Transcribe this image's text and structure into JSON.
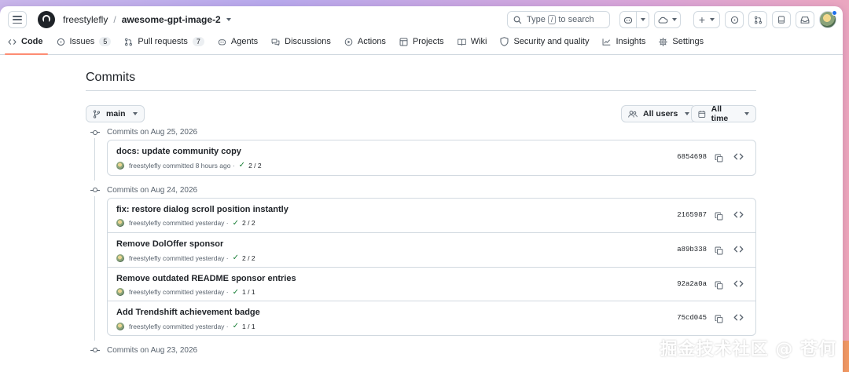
{
  "header": {
    "owner": "freestylefly",
    "separator": "/",
    "repo": "awesome-gpt-image-2",
    "search_prefix": "Type",
    "search_key": "/",
    "search_suffix": "to search"
  },
  "tabs": [
    {
      "label": "Code",
      "icon": "code-icon",
      "active": true
    },
    {
      "label": "Issues",
      "icon": "issue-icon",
      "count": "5"
    },
    {
      "label": "Pull requests",
      "icon": "pull-request-icon",
      "count": "7"
    },
    {
      "label": "Agents",
      "icon": "agents-icon"
    },
    {
      "label": "Discussions",
      "icon": "discussion-icon"
    },
    {
      "label": "Actions",
      "icon": "play-icon"
    },
    {
      "label": "Projects",
      "icon": "table-icon"
    },
    {
      "label": "Wiki",
      "icon": "book-icon"
    },
    {
      "label": "Security and quality",
      "icon": "shield-icon"
    },
    {
      "label": "Insights",
      "icon": "graph-icon"
    },
    {
      "label": "Settings",
      "icon": "gear-icon"
    }
  ],
  "page": {
    "title": "Commits",
    "branch": "main",
    "users_filter": "All users",
    "time_filter": "All time"
  },
  "groups": [
    {
      "heading": "Commits on Aug 25, 2026",
      "commits": [
        {
          "message": "docs: update community copy",
          "author": "freestylefly",
          "when": "committed 8 hours ago",
          "checks": "2 / 2",
          "sha": "6854698"
        }
      ]
    },
    {
      "heading": "Commits on Aug 24, 2026",
      "commits": [
        {
          "message": "fix: restore dialog scroll position instantly",
          "author": "freestylefly",
          "when": "committed yesterday",
          "checks": "2 / 2",
          "sha": "2165987"
        },
        {
          "message": "Remove DolOffer sponsor",
          "author": "freestylefly",
          "when": "committed yesterday",
          "checks": "2 / 2",
          "sha": "a89b338"
        },
        {
          "message": "Remove outdated README sponsor entries",
          "author": "freestylefly",
          "when": "committed yesterday",
          "checks": "1 / 1",
          "sha": "92a2a0a"
        },
        {
          "message": "Add Trendshift achievement badge",
          "author": "freestylefly",
          "when": "committed yesterday",
          "checks": "1 / 1",
          "sha": "75cd045"
        }
      ]
    },
    {
      "heading": "Commits on Aug 23, 2026",
      "commits": []
    }
  ],
  "watermark": {
    "text": "掘金技术社区 @ 苍何",
    "small": "苍何"
  },
  "colors": {
    "accent_underline": "#fd8c73",
    "check_green": "#1a7f37",
    "border": "#d1d9e0"
  }
}
